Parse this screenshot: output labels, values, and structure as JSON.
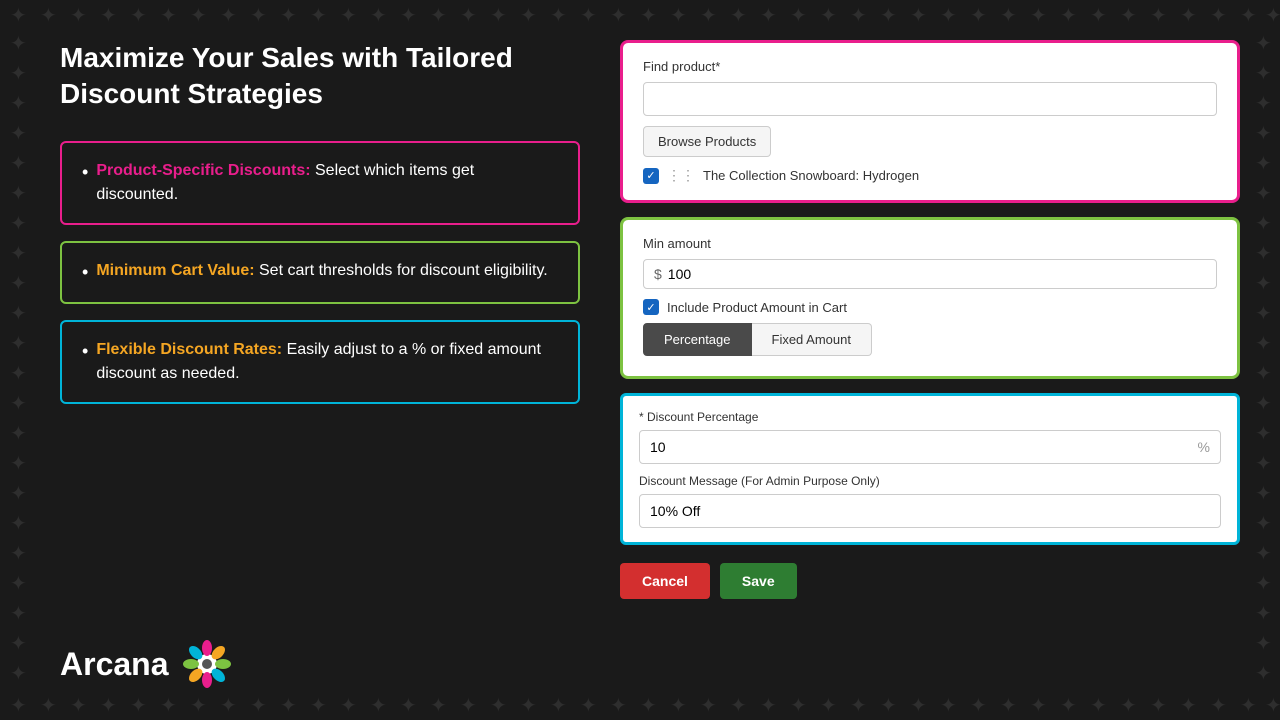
{
  "page": {
    "background_color": "#1a1a1a"
  },
  "headline": {
    "line1": "Maximize Your Sales with Tailored",
    "line2": "Discount Strategies"
  },
  "features": [
    {
      "id": "product-specific",
      "title": "Product-Specific Discounts:",
      "description": " Select which items get discounted.",
      "border_color": "pink"
    },
    {
      "id": "minimum-cart",
      "title": "Minimum Cart Value:",
      "description": " Set cart thresholds for discount eligibility.",
      "border_color": "green"
    },
    {
      "id": "flexible-rates",
      "title": "Flexible Discount Rates:",
      "description": " Easily adjust to a %  or fixed amount discount as needed.",
      "border_color": "cyan"
    }
  ],
  "logo": {
    "text": "Arcana"
  },
  "find_product": {
    "label": "Find product*",
    "input_value": "",
    "input_placeholder": "",
    "browse_button": "Browse Products",
    "product_item": "The Collection Snowboard: Hydrogen"
  },
  "min_amount": {
    "label": "Min amount",
    "currency": "$",
    "value": "100",
    "checkbox_label": "Include Product Amount in Cart",
    "toggle_percentage": "Percentage",
    "toggle_fixed": "Fixed Amount",
    "active_toggle": "percentage"
  },
  "discount": {
    "percentage_label": "* Discount Percentage",
    "percentage_value": "10",
    "percentage_symbol": "%",
    "message_label": "Discount Message (For Admin Purpose Only)",
    "message_value": "10% Off"
  },
  "actions": {
    "cancel_label": "Cancel",
    "save_label": "Save"
  }
}
